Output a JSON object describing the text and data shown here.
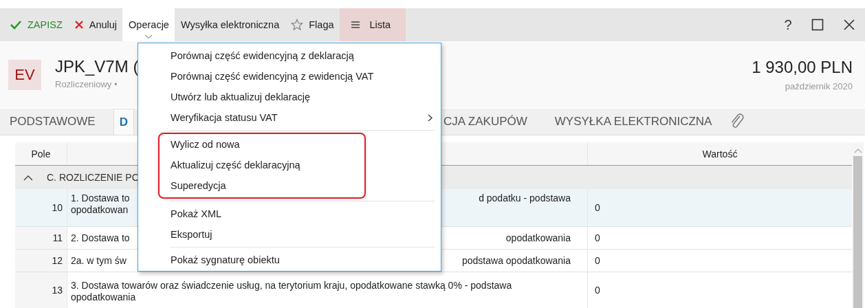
{
  "toolbar": {
    "items": [
      {
        "label": "ZAPISZ",
        "kind": "primary",
        "selected": false
      },
      {
        "label": "Anuluj",
        "kind": "plain",
        "selected": false
      },
      {
        "label": "Operacje",
        "kind": "plain",
        "selected": true
      },
      {
        "label": "Wysyłka elektroniczna",
        "kind": "plain",
        "selected": false
      },
      {
        "label": "Flaga",
        "kind": "plain",
        "selected": false
      },
      {
        "label": "Lista",
        "kind": "accent",
        "selected": false
      }
    ],
    "help": "?"
  },
  "header": {
    "badge": "EV",
    "title": "JPK_V7M (",
    "subtitle": "Rozliczeniowy •",
    "amount": "1 930,00 PLN",
    "period": "październik 2020"
  },
  "tabs": [
    {
      "label": "PODSTAWOWE",
      "selected": false
    },
    {
      "label": "D",
      "selected": true
    },
    {
      "label": "CJA ZAKUPÓW",
      "selected": false
    },
    {
      "label": "WYSYŁKA ELEKTRONICZNA",
      "selected": false
    }
  ],
  "table": {
    "columns": [
      "Pole",
      "Wartość"
    ],
    "group": {
      "label": "C. ROZLICZENIE PO",
      "expanded": true
    },
    "rows": [
      {
        "field": "10",
        "description_start": "1. Dostawa to\nopodatkowan",
        "description_end": "d podatku - podstawa",
        "value": "0",
        "selected": true
      },
      {
        "field": "11",
        "description_start": "2. Dostawa to",
        "description_end": "opodatkowania",
        "value": "0",
        "selected": false
      },
      {
        "field": "12",
        "description_start": "2a. w tym św",
        "description_end": "podstawa opodatkowania",
        "value": "0",
        "selected": false
      },
      {
        "field": "13",
        "description_start": "3. Dostawa towarów oraz świadczenie usług, na terytorium kraju, opodatkowane stawką 0% - podstawa opodatkowania",
        "description_end": "",
        "value": "0",
        "selected": false
      }
    ]
  },
  "menu": {
    "sections": [
      {
        "highlighted": false,
        "items": [
          {
            "label": "Porównaj część ewidencyjną z deklaracją",
            "submenu": false
          },
          {
            "label": "Porównaj część ewidencyjną z ewidencją VAT",
            "submenu": false
          },
          {
            "label": "Utwórz lub aktualizuj deklarację",
            "submenu": false
          },
          {
            "label": "Weryfikacja statusu VAT",
            "submenu": true
          }
        ]
      },
      {
        "highlighted": true,
        "items": [
          {
            "label": "Wylicz od nowa",
            "submenu": false
          },
          {
            "label": "Aktualizuj część deklaracyjną",
            "submenu": false
          },
          {
            "label": "Superedycja",
            "submenu": false
          }
        ]
      },
      {
        "highlighted": false,
        "items": [
          {
            "label": "Pokaż XML",
            "submenu": false
          },
          {
            "label": "Eksportuj",
            "submenu": false
          }
        ]
      },
      {
        "highlighted": false,
        "items": [
          {
            "label": "Pokaż sygnaturę obiektu",
            "submenu": false
          }
        ]
      }
    ]
  }
}
